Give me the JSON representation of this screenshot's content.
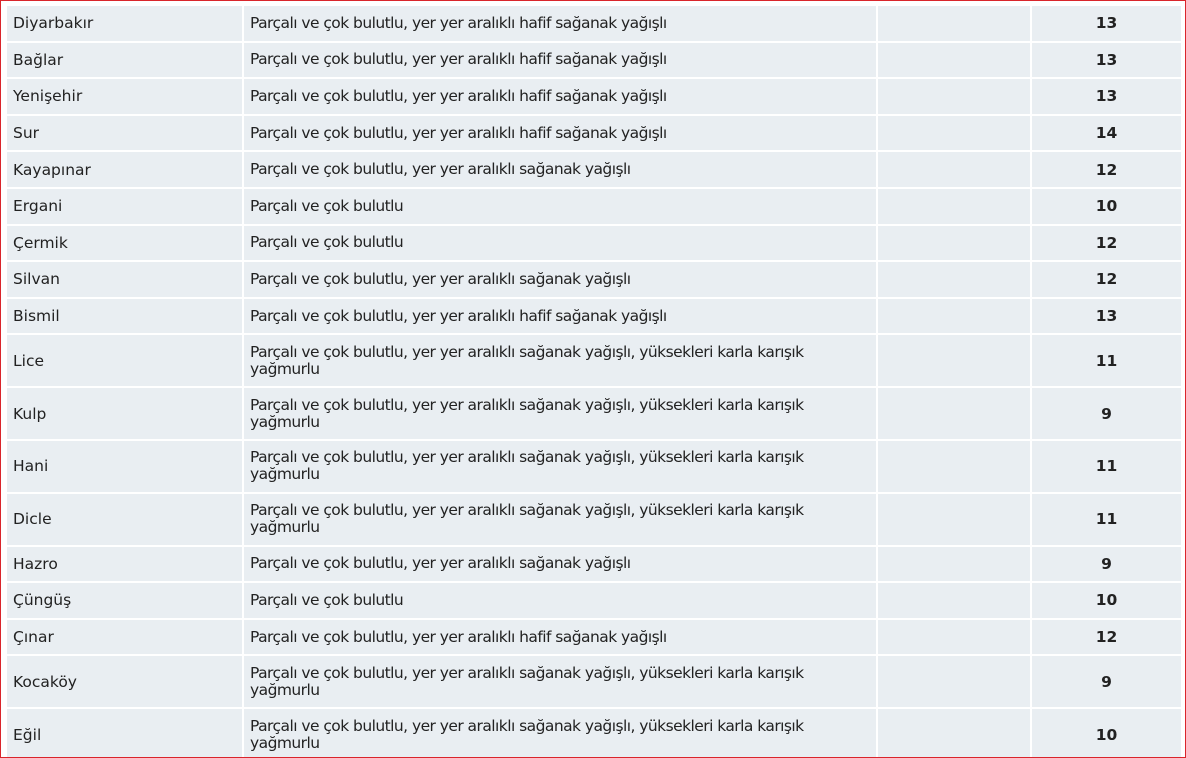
{
  "forecast": {
    "rows": [
      {
        "district": "Diyarbakır",
        "description": "Parçalı ve çok bulutlu, yer yer aralıklı hafif sağanak yağışlı",
        "temperature": "13"
      },
      {
        "district": "Bağlar",
        "description": "Parçalı ve çok bulutlu, yer yer aralıklı hafif sağanak yağışlı",
        "temperature": "13"
      },
      {
        "district": "Yenişehir",
        "description": "Parçalı ve çok bulutlu, yer yer aralıklı hafif sağanak yağışlı",
        "temperature": "13"
      },
      {
        "district": "Sur",
        "description": "Parçalı ve çok bulutlu, yer yer aralıklı hafif sağanak yağışlı",
        "temperature": "14"
      },
      {
        "district": "Kayapınar",
        "description": "Parçalı ve çok bulutlu, yer yer aralıklı sağanak yağışlı",
        "temperature": "12"
      },
      {
        "district": "Ergani",
        "description": "Parçalı ve çok bulutlu",
        "temperature": "10"
      },
      {
        "district": "Çermik",
        "description": "Parçalı ve çok bulutlu",
        "temperature": "12"
      },
      {
        "district": "Silvan",
        "description": "Parçalı ve çok bulutlu, yer yer aralıklı sağanak yağışlı",
        "temperature": "12"
      },
      {
        "district": "Bismil",
        "description": "Parçalı ve çok bulutlu, yer yer aralıklı hafif sağanak yağışlı",
        "temperature": "13"
      },
      {
        "district": "Lice",
        "description": "Parçalı ve çok bulutlu, yer yer aralıklı sağanak yağışlı, yüksekleri karla karışık yağmurlu",
        "temperature": "11"
      },
      {
        "district": "Kulp",
        "description": "Parçalı ve çok bulutlu, yer yer aralıklı sağanak yağışlı, yüksekleri karla karışık yağmurlu",
        "temperature": "9"
      },
      {
        "district": "Hani",
        "description": "Parçalı ve çok bulutlu, yer yer aralıklı sağanak yağışlı, yüksekleri karla karışık yağmurlu",
        "temperature": "11"
      },
      {
        "district": "Dicle",
        "description": "Parçalı ve çok bulutlu, yer yer aralıklı sağanak yağışlı, yüksekleri karla karışık yağmurlu",
        "temperature": "11"
      },
      {
        "district": "Hazro",
        "description": "Parçalı ve çok bulutlu, yer yer aralıklı sağanak yağışlı",
        "temperature": "9"
      },
      {
        "district": "Çüngüş",
        "description": "Parçalı ve çok bulutlu",
        "temperature": "10"
      },
      {
        "district": "Çınar",
        "description": "Parçalı ve çok bulutlu, yer yer aralıklı hafif sağanak yağışlı",
        "temperature": "12"
      },
      {
        "district": "Kocaköy",
        "description": "Parçalı ve çok bulutlu, yer yer aralıklı sağanak yağışlı, yüksekleri karla karışık yağmurlu",
        "temperature": "9"
      },
      {
        "district": "Eğil",
        "description": "Parçalı ve çok bulutlu, yer yer aralıklı sağanak yağışlı, yüksekleri karla karışık yağmurlu",
        "temperature": "10"
      }
    ]
  },
  "colors": {
    "frame_border": "#d9252b",
    "cell_background": "#e9eef2",
    "temperature_text": "#d9353a"
  }
}
